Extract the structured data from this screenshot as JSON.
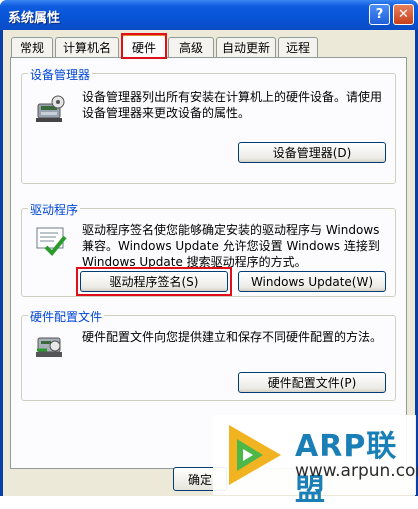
{
  "window": {
    "title": "系统属性",
    "help_label": "?",
    "close_label": "✕"
  },
  "tabs": [
    {
      "label": "常规"
    },
    {
      "label": "计算机名"
    },
    {
      "label": "硬件",
      "active": true
    },
    {
      "label": "高级"
    },
    {
      "label": "自动更新"
    },
    {
      "label": "远程"
    }
  ],
  "device_manager": {
    "group_label": "设备管理器",
    "description": "设备管理器列出所有安装在计算机上的硬件设备。请使用设备管理器来更改设备的属性。",
    "button_label": "设备管理器(D)"
  },
  "drivers": {
    "group_label": "驱动程序",
    "description": "驱动程序签名使您能够确定安装的驱动程序与 Windows 兼容。Windows Update 允许您设置 Windows 连接到 Windows Update 搜索驱动程序的方式。",
    "signing_button_label": "驱动程序签名(S)",
    "update_button_label": "Windows Update(W)"
  },
  "hardware_profiles": {
    "group_label": "硬件配置文件",
    "description": "硬件配置文件向您提供建立和保存不同硬件配置的方法。",
    "button_label": "硬件配置文件(P)"
  },
  "footer": {
    "ok_label": "确定"
  },
  "watermark": {
    "title": "ARP联盟",
    "url": "www.arpun.com"
  },
  "colors": {
    "titlebar": "#0753d6",
    "dialog_bg": "#ece9d8",
    "group_label": "#0046d5",
    "highlight": "#e0101a"
  }
}
